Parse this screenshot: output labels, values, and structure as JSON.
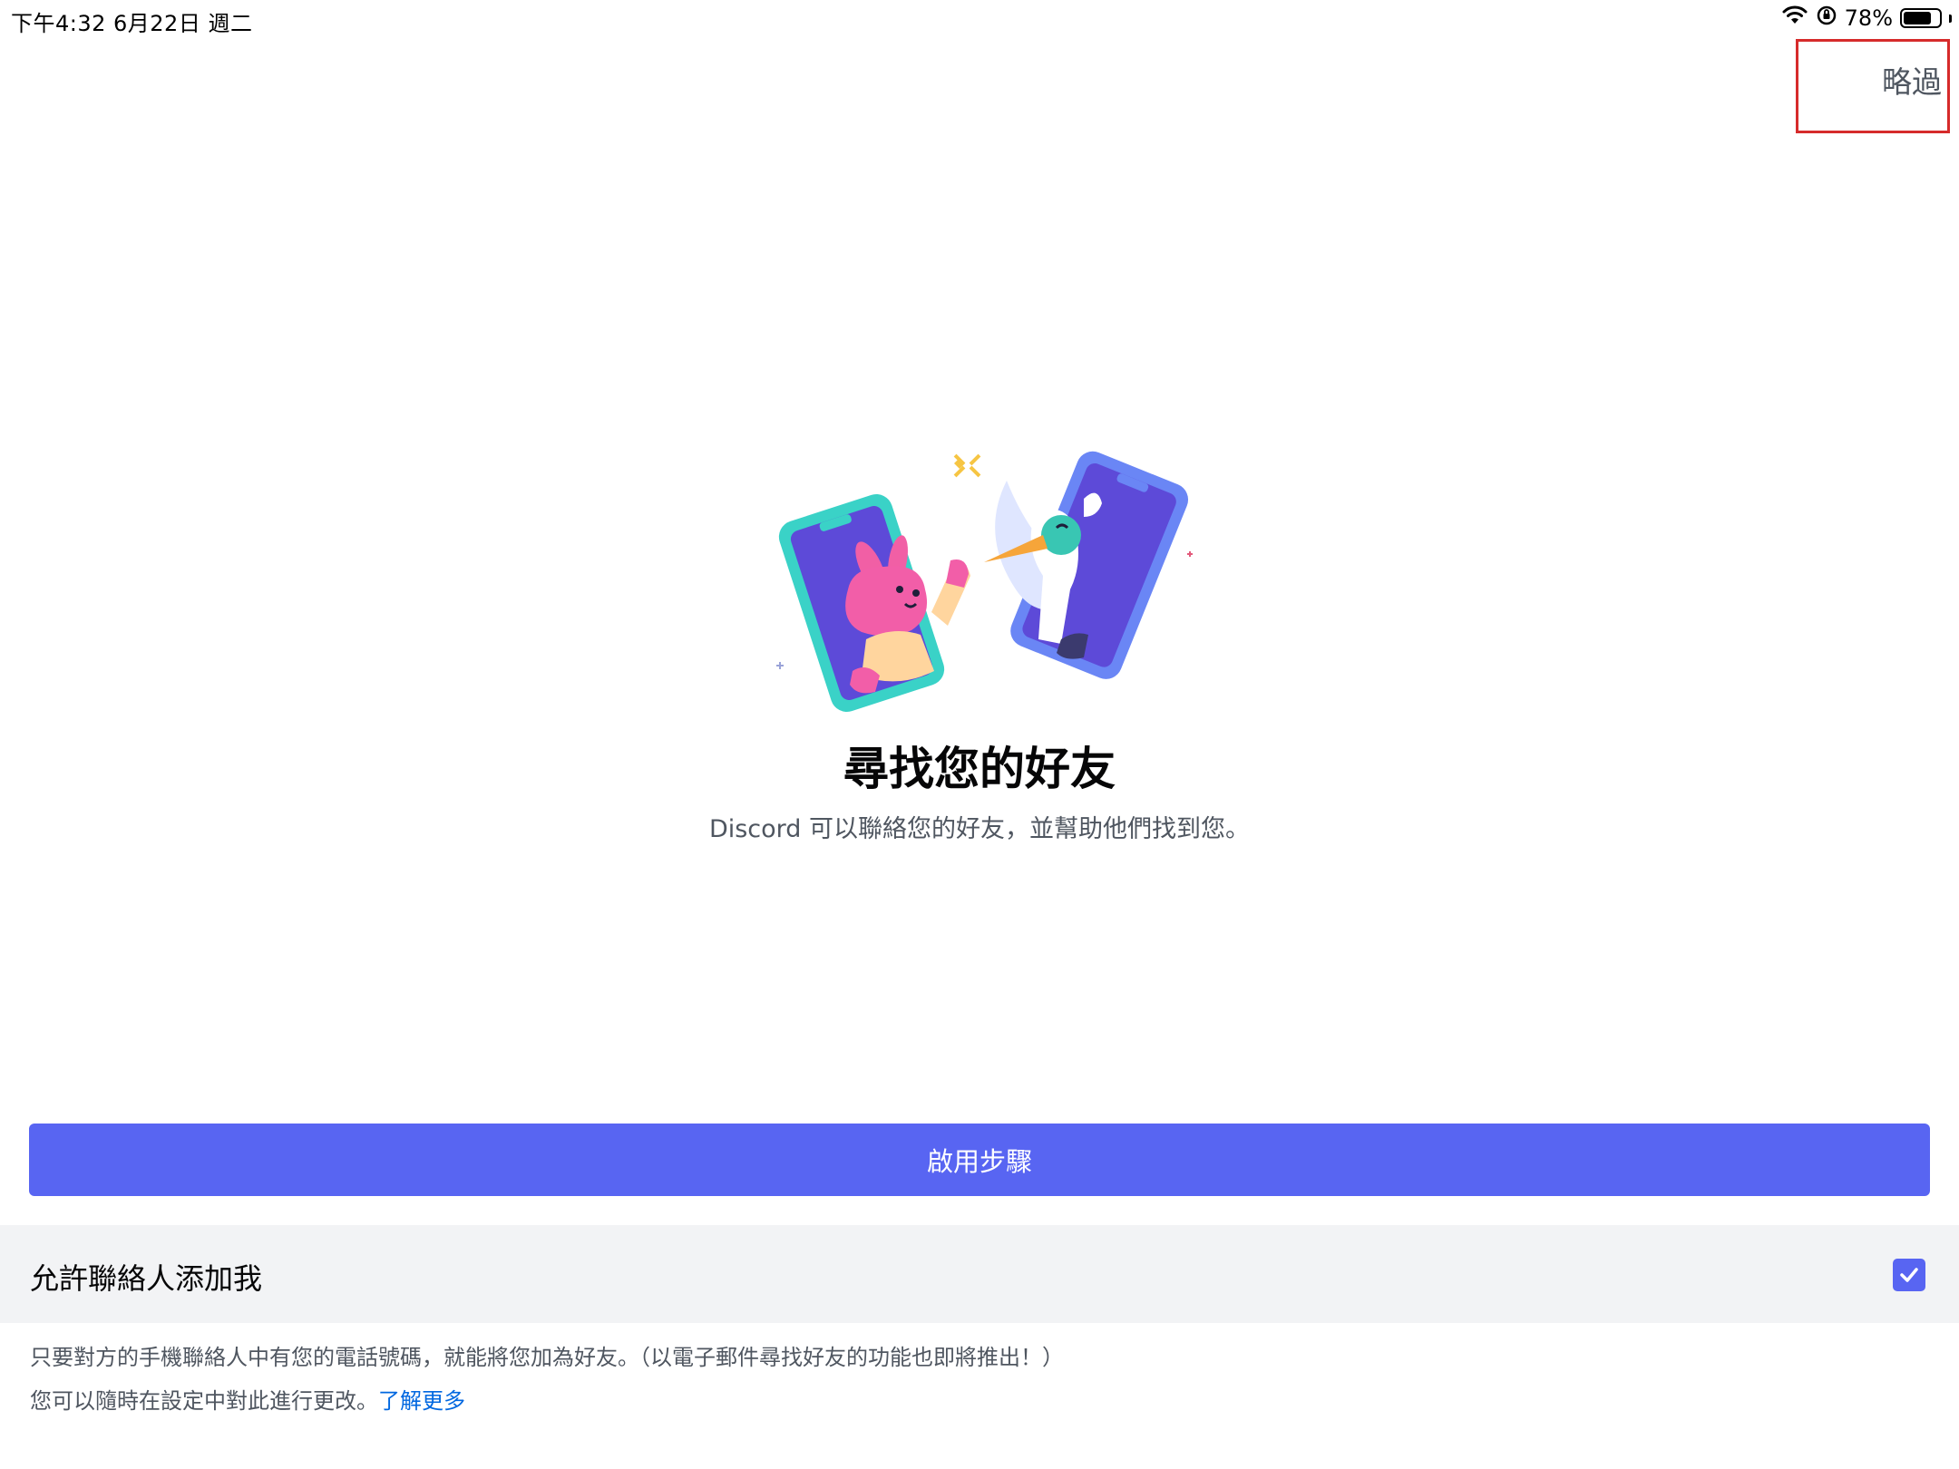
{
  "status_bar": {
    "time": "下午4:32   6月22日 週二",
    "battery_percent": "78%",
    "battery_level": 0.78,
    "icons": [
      "wifi-icon",
      "orientation-lock-icon",
      "battery-icon"
    ]
  },
  "header": {
    "skip_label": "略過"
  },
  "main": {
    "title": "尋找您的好友",
    "subtitle": "Discord 可以聯絡您的好友，並幫助他們找到您。",
    "primary_button_label": "啟用步驟"
  },
  "contacts_setting": {
    "label": "允許聯絡人添加我",
    "checked": true
  },
  "footnote": {
    "line1": "只要對方的手機聯絡人中有您的電話號碼，就能將您加為好友。（以電子郵件尋找好友的功能也即將推出！）",
    "line2": "您可以隨時在設定中對此進行更改。",
    "learn_more": "了解更多"
  },
  "colors": {
    "brand": "#5865f2",
    "link": "#0067e0",
    "highlight_box": "#d62b2b"
  }
}
